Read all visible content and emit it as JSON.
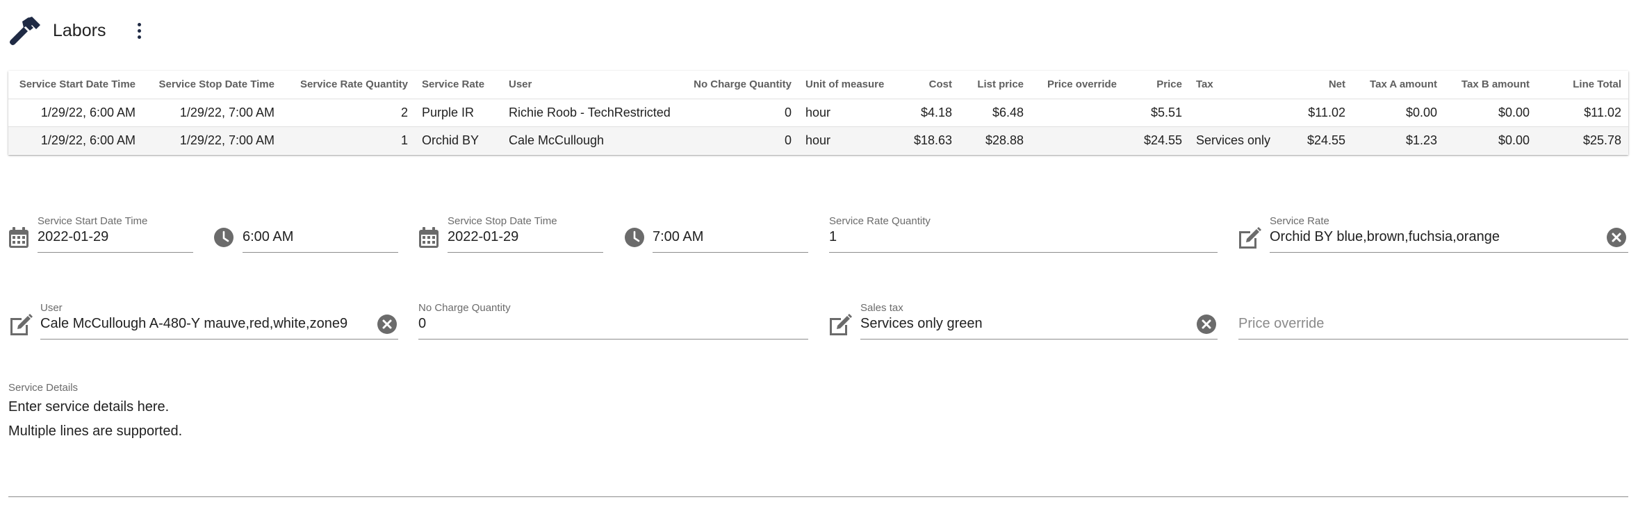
{
  "header": {
    "title": "Labors",
    "icon": "hammer-icon",
    "menu_icon": "more-vert-icon"
  },
  "table": {
    "columns": [
      "Service Start Date Time",
      "Service Stop Date Time",
      "Service Rate Quantity",
      "Service Rate",
      "User",
      "No Charge Quantity",
      "Unit of measure",
      "Cost",
      "List price",
      "Price override",
      "Price",
      "Tax",
      "Net",
      "Tax A amount",
      "Tax B amount",
      "Line Total"
    ],
    "rows": [
      [
        "1/29/22, 6:00 AM",
        "1/29/22, 7:00 AM",
        "2",
        "Purple IR",
        "Richie Roob - TechRestricted",
        "0",
        "hour",
        "$4.18",
        "$6.48",
        "",
        "$5.51",
        "",
        "$11.02",
        "$0.00",
        "$0.00",
        "$11.02"
      ],
      [
        "1/29/22, 6:00 AM",
        "1/29/22, 7:00 AM",
        "1",
        "Orchid BY",
        "Cale McCullough",
        "0",
        "hour",
        "$18.63",
        "$28.88",
        "",
        "$24.55",
        "Services only",
        "$24.55",
        "$1.23",
        "$0.00",
        "$25.78"
      ]
    ]
  },
  "form": {
    "start_date": {
      "label": "Service Start Date Time",
      "value": "2022-01-29"
    },
    "start_time": {
      "value": "6:00 AM"
    },
    "stop_date": {
      "label": "Service Stop Date Time",
      "value": "2022-01-29"
    },
    "stop_time": {
      "value": "7:00 AM"
    },
    "rate_quantity": {
      "label": "Service Rate Quantity",
      "value": "1"
    },
    "service_rate": {
      "label": "Service Rate",
      "value": "Orchid BY blue,brown,fuchsia,orange"
    },
    "user": {
      "label": "User",
      "value": "Cale McCullough A-480-Y mauve,red,white,zone9"
    },
    "no_charge_quantity": {
      "label": "No Charge Quantity",
      "value": "0"
    },
    "sales_tax": {
      "label": "Sales tax",
      "value": "Services only green"
    },
    "price_override": {
      "placeholder": "Price override"
    },
    "service_details": {
      "label": "Service Details",
      "value": "Enter service details here.\nMultiple lines are supported."
    }
  },
  "colors": {
    "hammer": "#1f2a44",
    "icon_gray": "#6b6b6b"
  }
}
